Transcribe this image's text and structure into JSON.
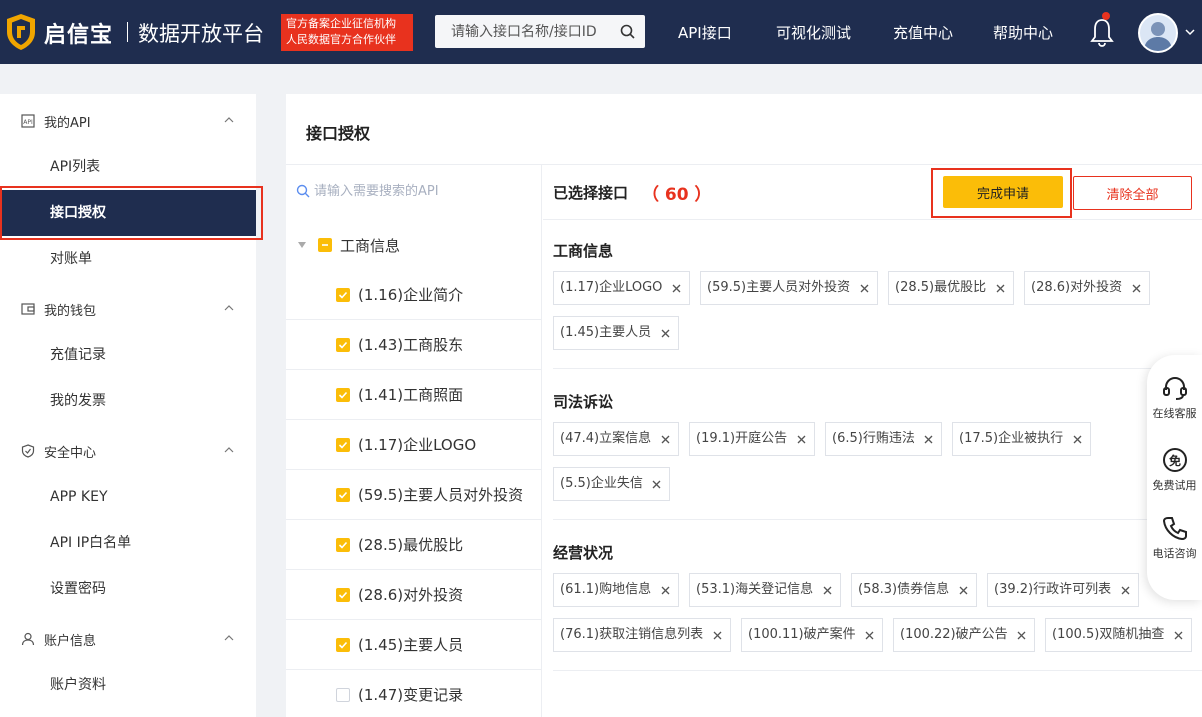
{
  "header": {
    "logo_name": "启信宝",
    "platform": "数据开放平台",
    "badge_line1": "官方备案企业征信机构",
    "badge_line2": "人民数据官方合作伙伴",
    "search_placeholder": "请输入接口名称/接口ID",
    "nav": [
      "API接口",
      "可视化测试",
      "充值中心",
      "帮助中心"
    ]
  },
  "sidebar": {
    "groups": [
      {
        "label": "我的API",
        "icon": "api-icon",
        "items": [
          "API列表",
          "接口授权",
          "对账单"
        ]
      },
      {
        "label": "我的钱包",
        "icon": "wallet-icon",
        "items": [
          "充值记录",
          "我的发票"
        ]
      },
      {
        "label": "安全中心",
        "icon": "shield-icon",
        "items": [
          "APP KEY",
          "API IP白名单",
          "设置密码"
        ]
      },
      {
        "label": "账户信息",
        "icon": "user-icon",
        "items": [
          "账户资料"
        ]
      }
    ],
    "active_item": "接口授权"
  },
  "main": {
    "title": "接口授权",
    "tree": {
      "search_placeholder": "请输入需要搜索的API",
      "root_label": "工商信息",
      "items": [
        {
          "label": "(1.16)企业简介",
          "checked": true
        },
        {
          "label": "(1.43)工商股东",
          "checked": true
        },
        {
          "label": "(1.41)工商照面",
          "checked": true
        },
        {
          "label": "(1.17)企业LOGO",
          "checked": true
        },
        {
          "label": "(59.5)主要人员对外投资",
          "checked": true
        },
        {
          "label": "(28.5)最优股比",
          "checked": true
        },
        {
          "label": "(28.6)对外投资",
          "checked": true
        },
        {
          "label": "(1.45)主要人员",
          "checked": true
        },
        {
          "label": "(1.47)变更记录",
          "checked": false
        }
      ]
    },
    "selected": {
      "title": "已选择接口",
      "count": "（ 60 ）",
      "finish_label": "完成申请",
      "clear_label": "清除全部",
      "categories": [
        {
          "title": "工商信息",
          "tags": [
            "(1.17)企业LOGO",
            "(59.5)主要人员对外投资",
            "(28.5)最优股比",
            "(28.6)对外投资",
            "(1.45)主要人员"
          ]
        },
        {
          "title": "司法诉讼",
          "tags": [
            "(47.4)立案信息",
            "(19.1)开庭公告",
            "(6.5)行贿违法",
            "(17.5)企业被执行",
            "(5.5)企业失信"
          ]
        },
        {
          "title": "经营状况",
          "tags": [
            "(61.1)购地信息",
            "(53.1)海关登记信息",
            "(58.3)债券信息",
            "(39.2)行政许可列表",
            "(76.1)获取注销信息列表",
            "(100.11)破产案件",
            "(100.22)破产公告",
            "(100.5)双随机抽查"
          ]
        }
      ]
    }
  },
  "float_bar": [
    "在线客服",
    "免费试用",
    "电话咨询"
  ],
  "colors": {
    "nav_bg": "#1f2d4f",
    "accent_yellow": "#fbbd08",
    "accent_red": "#e8321e"
  }
}
